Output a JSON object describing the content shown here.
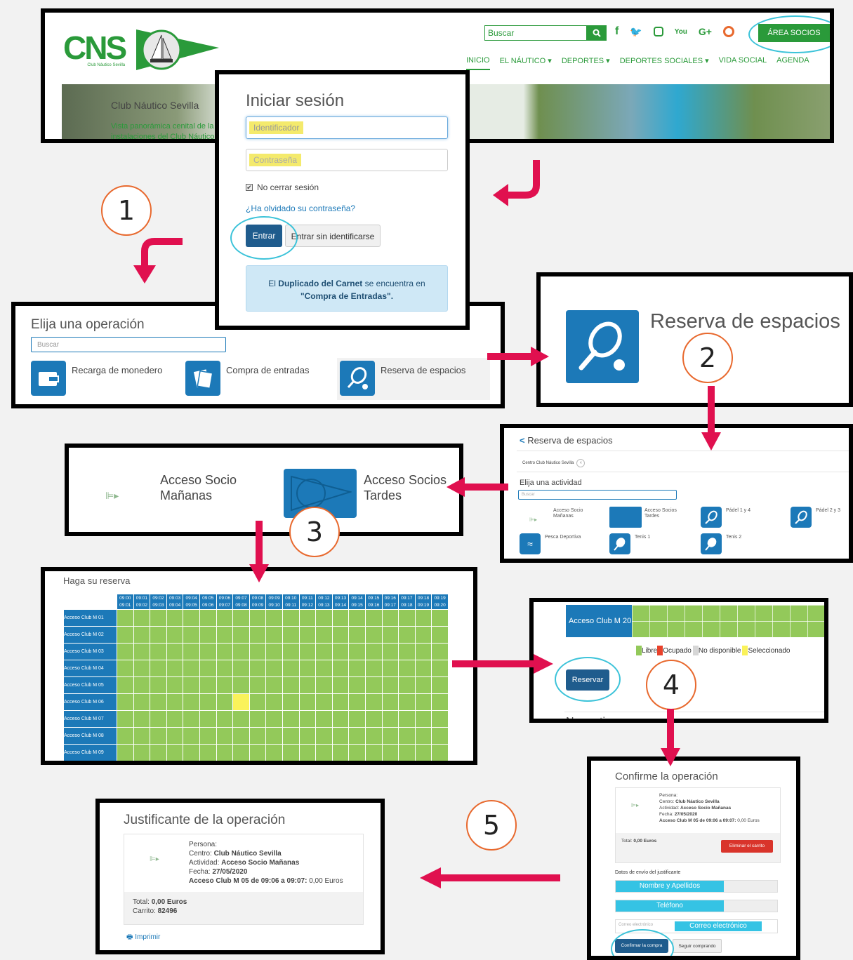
{
  "header": {
    "logo_text": "CNS",
    "logo_sub": "Club Náutico Sevilla",
    "pennant_top": "CLUB NAUTICO",
    "pennant_bottom": "SEVILLA",
    "search_placeholder": "Buscar",
    "area_socios": "ÁREA SOCIOS",
    "nav": [
      "INICIO",
      "EL NÁUTICO ▾",
      "DEPORTES ▾",
      "DEPORTES SOCIALES ▾",
      "VIDA SOCIAL",
      "AGENDA"
    ],
    "hero_title": "Club Náutico Sevilla",
    "hero_caption_1": "Vista panorámica cenital de la",
    "hero_caption_2": "instalaciones del Club Náutico"
  },
  "login": {
    "title": "Iniciar sesión",
    "id_placeholder": "Identificador",
    "pwd_placeholder": "Contraseña",
    "keep_session": "No cerrar sesión",
    "forgot": "¿Ha olvidado su contraseña?",
    "enter": "Entrar",
    "enter_anon": "Entrar sin identificarse",
    "info_1": "El ",
    "info_bold": "Duplicado del Carnet",
    "info_2": " se encuentra en",
    "info_3": "\"Compra de Entradas\"."
  },
  "steps": [
    "1",
    "2",
    "3",
    "4",
    "5"
  ],
  "operation": {
    "title": "Elija una operación",
    "search_placeholder": "Buscar",
    "items": [
      "Recarga de monedero",
      "Compra de entradas",
      "Reserva de espacios"
    ]
  },
  "reserva_big": {
    "title": "Reserva de espacios"
  },
  "activity": {
    "back_title": "Reserva de espacios",
    "centro": "Centro Club Náutico Sevilla",
    "choose": "Elija una actividad",
    "search_placeholder": "Buscar",
    "items": [
      "Acceso Socio Mañanas",
      "Acceso Socios Tardes",
      "Pádel 1 y 4",
      "Pádel 2 y 3",
      "Pesca Deportiva",
      "Tenis 1",
      "Tenis 2"
    ]
  },
  "acceso": {
    "manana_1": "Acceso Socio",
    "manana_2": "Mañanas",
    "tardes_1": "Acceso Socios",
    "tardes_2": "Tardes"
  },
  "grid": {
    "title": "Haga su reserva",
    "cols_top": [
      "09:00",
      "09:01",
      "09:02",
      "09:03",
      "09:04",
      "09:05",
      "09:06",
      "09:07",
      "09:08",
      "09:09",
      "09:10",
      "09:11",
      "09:12",
      "09:13",
      "09:14",
      "09:15",
      "09:16",
      "09:17",
      "09:18",
      "09:19"
    ],
    "cols_bottom": [
      "09:01",
      "09:02",
      "09:03",
      "09:04",
      "09:05",
      "09:06",
      "09:07",
      "09:08",
      "09:09",
      "09:10",
      "09:11",
      "09:12",
      "09:13",
      "09:14",
      "09:15",
      "09:16",
      "09:17",
      "09:18",
      "09:19",
      "09:20"
    ],
    "rows": [
      "Acceso Club M 01",
      "Acceso Club M 02",
      "Acceso Club M 03",
      "Acceso Club M 04",
      "Acceso Club M 05",
      "Acceso Club M 06",
      "Acceso Club M 07",
      "Acceso Club M 08",
      "Acceso Club M 09"
    ],
    "selected_row": 5,
    "selected_col": 7,
    "colors": {
      "libre": "#93c95a",
      "ocupado": "#e8412b",
      "no_disponible": "#d6d6d6",
      "seleccionado": "#faf25a",
      "header": "#1c79b8"
    }
  },
  "legend": {
    "row_label": "Acceso Club M 20",
    "libre": "Libre",
    "ocupado": "Ocupado",
    "no_disponible": "No disponible",
    "seleccionado": "Seleccionado",
    "reservar": "Reservar",
    "normativa": "Normativa"
  },
  "confirm": {
    "title": "Confirme la operación",
    "persona": "Persona:",
    "centro_lbl": "Centro: ",
    "centro": "Club Náutico Sevilla",
    "actividad_lbl": "Actividad: ",
    "actividad": "Acceso Socio Mañanas",
    "fecha_lbl": "Fecha: ",
    "fecha": "27/05/2020",
    "linea": "Acceso Club M 05 de 09:06 a 09:07:",
    "importe": " 0,00 Euros",
    "total_lbl": "Total: ",
    "total": "0,00 Euros",
    "eliminar": "Eliminar el carrito",
    "datos_envio": "Datos de envío del justificante",
    "nombre": "Nombre y Apellidos",
    "telefono": "Teléfono",
    "correo_ph": "Correo electrónico",
    "correo": "Correo electrónico",
    "confirmar": "Confirmar la compra",
    "seguir": "Seguir comprando"
  },
  "receipt": {
    "title": "Justificante de la operación",
    "persona": "Persona:",
    "centro_lbl": "Centro: ",
    "centro": "Club Náutico Sevilla",
    "actividad_lbl": "Actividad: ",
    "actividad": "Acceso Socio Mañanas",
    "fecha_lbl": "Fecha: ",
    "fecha": "27/05/2020",
    "linea": "Acceso Club M 05 de 09:06 a 09:07:",
    "importe": " 0,00 Euros",
    "total_lbl": "Total: ",
    "total": "0,00 Euros",
    "carrito_lbl": "Carrito: ",
    "carrito": "82496",
    "imprimir": "Imprimir"
  },
  "palette": {
    "accent_blue": "#1c79b8",
    "arrow": "#e0104f",
    "cns_green": "#2a9a3a",
    "circle_orange": "#e8692e",
    "highlight": "#3cc3d9"
  }
}
